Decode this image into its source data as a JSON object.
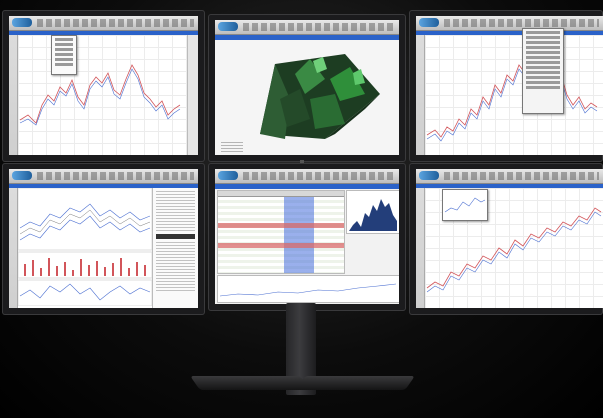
{
  "scene": {
    "description_tag": "",
    "monitors": [
      "top-left",
      "top-center",
      "top-right",
      "bottom-left",
      "bottom-center",
      "bottom-right"
    ]
  },
  "colors": {
    "accent_blue": "#2a62c9",
    "price_red": "#d2555a",
    "price_blue": "#4b6fd1",
    "terrain_green": "#2f8f3a"
  }
}
